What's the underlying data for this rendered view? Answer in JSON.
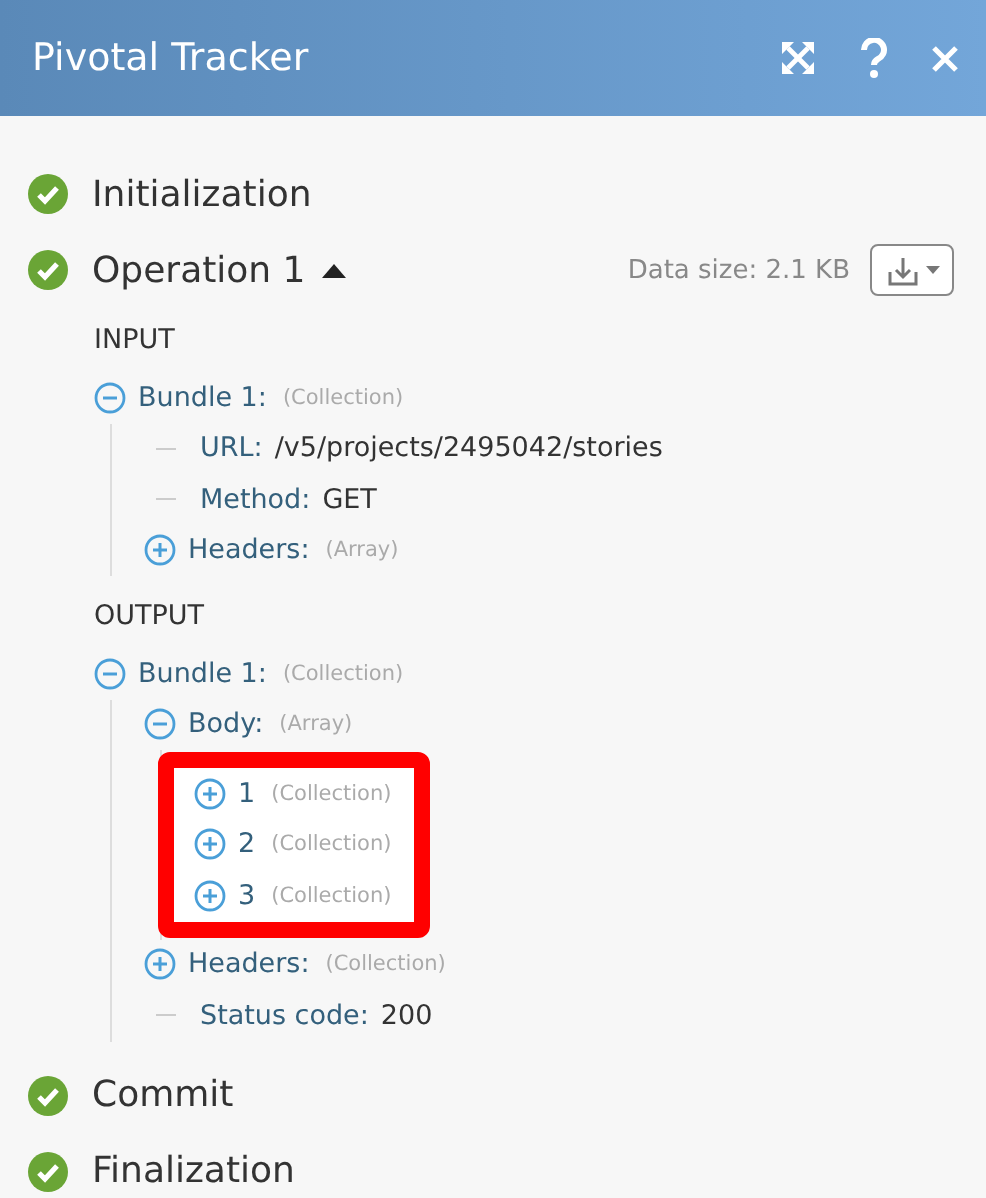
{
  "window": {
    "title": "Pivotal Tracker"
  },
  "steps": [
    {
      "label": "Initialization",
      "completed": true
    },
    {
      "label": "Operation 1",
      "completed": true,
      "expanded": true,
      "data_size": "Data size: 2.1 KB",
      "sections": [
        {
          "heading": "INPUT",
          "tree": [
            {
              "kind": "group",
              "key": "Bundle 1:",
              "type": "(Collection)",
              "expanded": true,
              "children": [
                {
                  "kind": "field",
                  "key": "URL:",
                  "value": "/v5/projects/2495042/stories"
                },
                {
                  "kind": "field",
                  "key": "Method:",
                  "value": "GET"
                },
                {
                  "kind": "group",
                  "key": "Headers:",
                  "type": "(Array)",
                  "expanded": false
                }
              ]
            }
          ]
        },
        {
          "heading": "OUTPUT",
          "tree": [
            {
              "kind": "group",
              "key": "Bundle 1:",
              "type": "(Collection)",
              "expanded": true,
              "children": [
                {
                  "kind": "group",
                  "key": "Body:",
                  "type": "(Array)",
                  "expanded": true,
                  "children_highlighted": true,
                  "children": [
                    {
                      "kind": "group",
                      "key": "1",
                      "type": "(Collection)",
                      "expanded": false
                    },
                    {
                      "kind": "group",
                      "key": "2",
                      "type": "(Collection)",
                      "expanded": false
                    },
                    {
                      "kind": "group",
                      "key": "3",
                      "type": "(Collection)",
                      "expanded": false
                    }
                  ]
                },
                {
                  "kind": "group",
                  "key": "Headers:",
                  "type": "(Collection)",
                  "expanded": false
                },
                {
                  "kind": "field",
                  "key": "Status code:",
                  "value": "200"
                }
              ]
            }
          ]
        }
      ]
    },
    {
      "label": "Commit",
      "completed": true
    },
    {
      "label": "Finalization",
      "completed": true
    }
  ]
}
